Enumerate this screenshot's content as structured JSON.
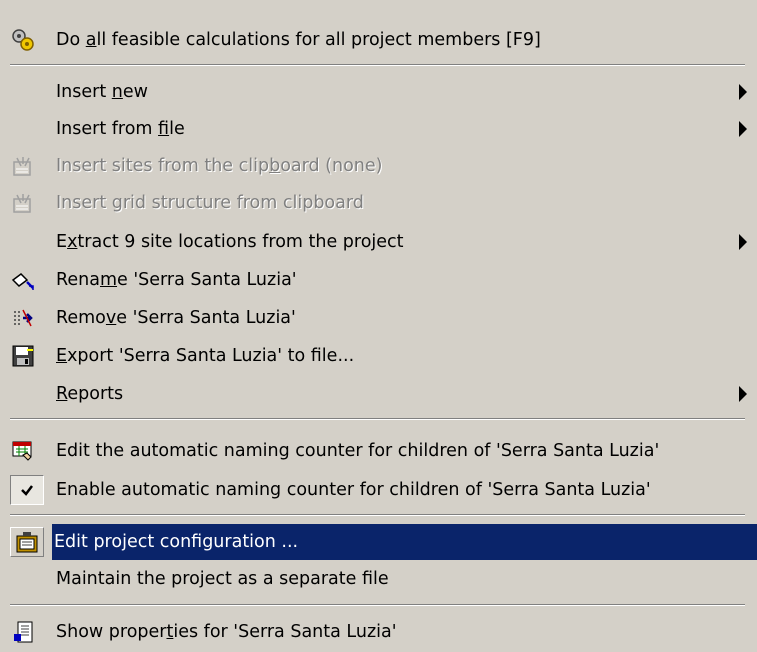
{
  "menu": {
    "items": [
      {
        "id": "calc",
        "label_pre": "Do ",
        "label_ul": "a",
        "label_post": "ll feasible calculations for all project members [F9]",
        "icon": "gears-icon"
      },
      {
        "id": "insert-new",
        "label_pre": "Insert ",
        "label_ul": "n",
        "label_post": "ew"
      },
      {
        "id": "insert-file",
        "label_pre": "Insert from ",
        "label_ul": "f",
        "label_post": "ile"
      },
      {
        "id": "insert-sites-clip",
        "label_pre": "Insert sites from the clip",
        "label_ul": "b",
        "label_post": "oard (none)",
        "icon": "paste-sites-icon",
        "disabled": true
      },
      {
        "id": "insert-grid-clip",
        "label_pre": "Insert grid structure from clipboard",
        "label_ul": "",
        "label_post": "",
        "icon": "paste-grid-icon",
        "disabled": true
      },
      {
        "id": "extract-sites",
        "label_pre": "E",
        "label_ul": "x",
        "label_post": "tract 9 site locations from the project"
      },
      {
        "id": "rename",
        "label_pre": "Rena",
        "label_ul": "m",
        "label_post": "e 'Serra Santa Luzia'",
        "icon": "rename-icon"
      },
      {
        "id": "remove",
        "label_pre": "Remo",
        "label_ul": "v",
        "label_post": "e 'Serra Santa Luzia'",
        "icon": "remove-icon"
      },
      {
        "id": "export",
        "label_pre": "",
        "label_ul": "E",
        "label_post": "xport 'Serra Santa Luzia' to file...",
        "icon": "export-icon"
      },
      {
        "id": "reports",
        "label_pre": "",
        "label_ul": "R",
        "label_post": "eports"
      },
      {
        "id": "edit-counter",
        "label_pre": "Edit the automatic naming counter for children of 'Serra Santa Luzia'",
        "label_ul": "",
        "label_post": "",
        "icon": "counter-icon"
      },
      {
        "id": "enable-counter",
        "label_pre": "Enable automatic naming counter for children of 'Serra Santa Luzia'",
        "label_ul": "",
        "label_post": "",
        "icon": "checkmark-icon",
        "checked": true
      },
      {
        "id": "edit-config",
        "label_pre": "Edit project configuration ...",
        "label_ul": "",
        "label_post": "",
        "icon": "config-icon",
        "highlighted": true
      },
      {
        "id": "maintain",
        "label_pre": "Maintain the project as a separate file",
        "label_ul": "",
        "label_post": ""
      },
      {
        "id": "show-props",
        "label_pre": "Show proper",
        "label_ul": "t",
        "label_post": "ies for 'Serra Santa Luzia'",
        "icon": "properties-icon"
      }
    ]
  },
  "colors": {
    "menu_bg": "#d4d0c8",
    "highlight_bg": "#0a246a",
    "highlight_text": "#ffffff",
    "disabled_text": "#808080"
  }
}
